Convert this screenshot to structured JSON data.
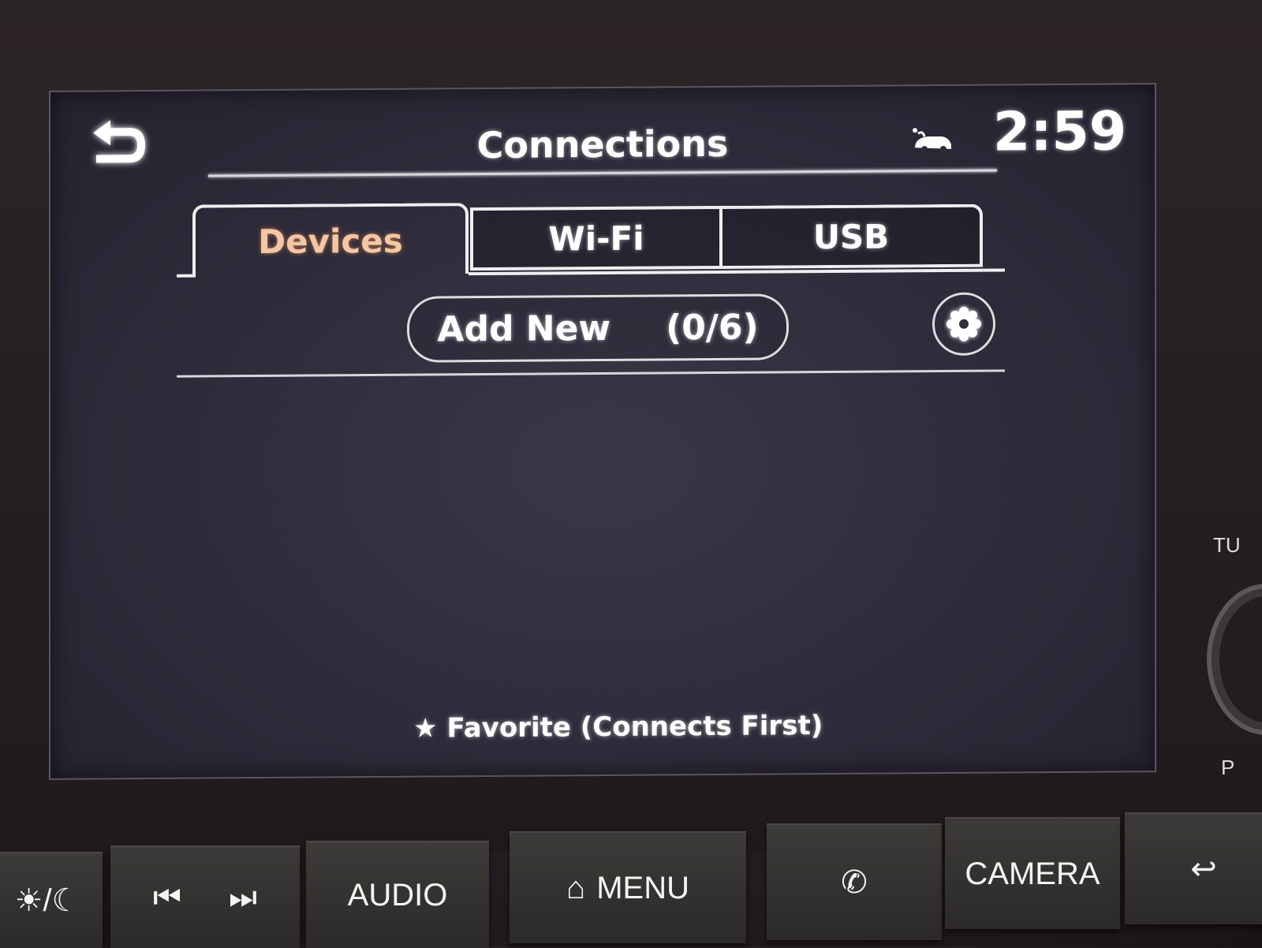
{
  "screen": {
    "header": {
      "back_icon": "back-arrow-icon",
      "title": "Connections",
      "status_icon": "connected-car-icon",
      "clock": "2:59"
    },
    "tabs": [
      {
        "label": "Devices",
        "active": true
      },
      {
        "label": "Wi-Fi",
        "active": false
      },
      {
        "label": "USB",
        "active": false
      }
    ],
    "add_new": {
      "label": "Add New",
      "count": "(0/6)"
    },
    "settings_icon": "gear-icon",
    "device_list": [],
    "footer_note": {
      "icon": "star-icon",
      "text": "Favorite (Connects First)"
    }
  },
  "hardware_buttons": [
    {
      "id": "day-night",
      "label": "☀/☾",
      "icon": "day-night-icon"
    },
    {
      "id": "seek",
      "icons": [
        "previous-track-icon",
        "next-track-icon"
      ]
    },
    {
      "id": "audio",
      "label": "AUDIO"
    },
    {
      "id": "menu",
      "label": "MENU",
      "icon": "home-icon"
    },
    {
      "id": "phone",
      "icon": "phone-icon"
    },
    {
      "id": "camera",
      "label": "CAMERA"
    },
    {
      "id": "back",
      "icon": "back-arrow-icon"
    }
  ],
  "side_labels": {
    "tune": "TU",
    "push": "P"
  },
  "colors": {
    "active_tab": "#f3c7a6",
    "text": "#ffffff",
    "screen_bg": "#2f2c3b"
  }
}
